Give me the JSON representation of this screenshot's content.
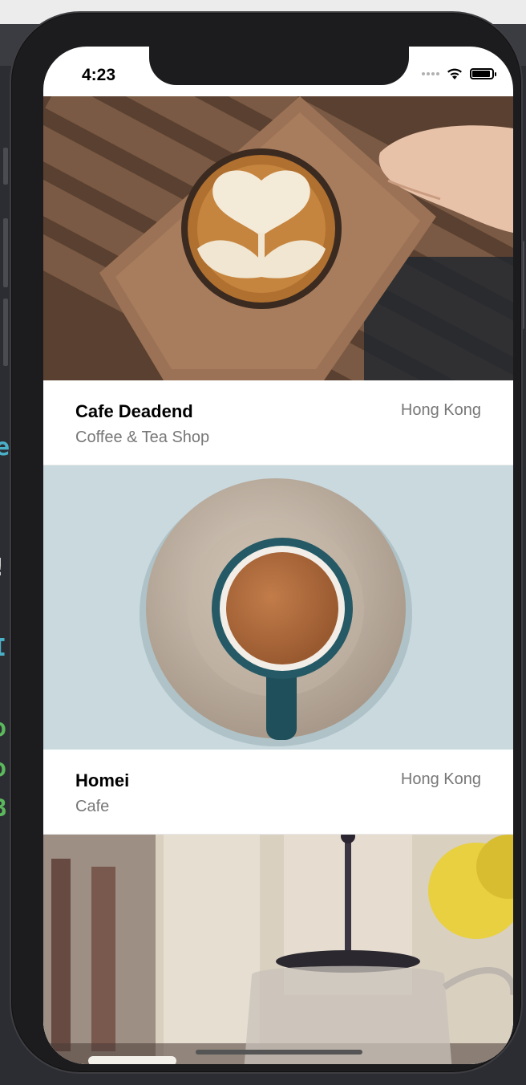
{
  "status_bar": {
    "time": "4:23",
    "icons": [
      "signal-dots-icon",
      "wifi-icon",
      "battery-icon"
    ]
  },
  "restaurants": [
    {
      "name": "Cafe Deadend",
      "type": "Coffee & Tea Shop",
      "location": "Hong Kong",
      "image": "latte-art-on-wooden-tray"
    },
    {
      "name": "Homei",
      "type": "Cafe",
      "location": "Hong Kong",
      "image": "tea-cup-on-saucer"
    },
    {
      "image": "french-press-teapot"
    }
  ],
  "colors": {
    "background": "#2b2d33",
    "secondary_text": "#777777",
    "primary_text": "#000000"
  }
}
